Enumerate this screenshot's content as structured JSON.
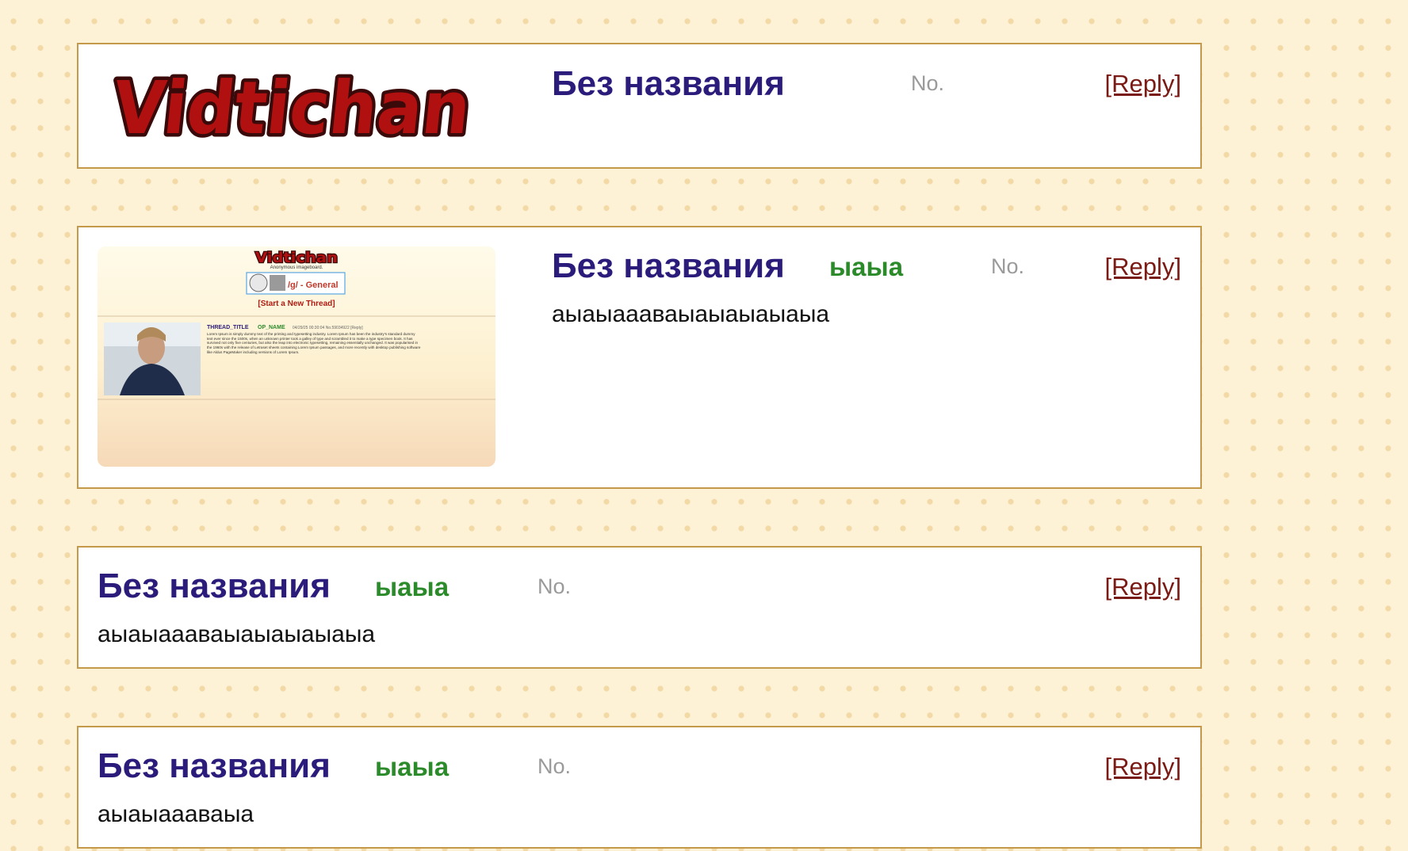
{
  "posts": [
    {
      "title": "Без названия",
      "name": "",
      "no_label": "No.",
      "reply_label": "[Reply]",
      "body": "",
      "image": "logo",
      "logo_text": "Vidtichan"
    },
    {
      "title": "Без названия",
      "name": "ыаыа",
      "no_label": "No.",
      "reply_label": "[Reply]",
      "body": "аыаыаааваыаыаыаыаыа",
      "image": "screenshot-thumbnail",
      "thumbnail": {
        "logo_text": "Vidtichan",
        "tagline": "Anonymous imageboard.",
        "board_label": "/g/ - General",
        "start_thread": "[Start a New Thread]",
        "thread_title": "THREAD_TITLE",
        "op_name": "OP_NAME",
        "meta": "04/29/25 00:30:04 No.59034922 [Reply]",
        "lorem": "Lorem Ipsum is simply dummy text of the printing and typesetting industry. Lorem Ipsum has been the industry's standard dummy text ever since the 1500s, when an unknown printer took a galley of type and scrambled it to make a type specimen book. It has survived not only five centuries, but also the leap into electronic typesetting, remaining essentially unchanged. It was popularised in the 1960s with the release of Letraset sheets containing Lorem Ipsum passages, and more recently with desktop publishing software like Aldus PageMaker including versions of Lorem Ipsum."
      }
    },
    {
      "title": "Без названия",
      "name": "ыаыа",
      "no_label": "No.",
      "reply_label": "[Reply]",
      "body": "аыаыаааваыаыаыаыаыа",
      "image": null
    },
    {
      "title": "Без названия",
      "name": "ыаыа",
      "no_label": "No.",
      "reply_label": "[Reply]",
      "body": "аыаыаааваыа",
      "image": null
    }
  ],
  "colors": {
    "background": "#fdf1d6",
    "dots": "#f2d9a6",
    "post_border": "#c49a4a",
    "title": "#2b1b7a",
    "name": "#2b8a2a",
    "reply": "#7a1a14",
    "logo_fill": "#b0100f",
    "logo_outline": "#3a0a0a"
  }
}
